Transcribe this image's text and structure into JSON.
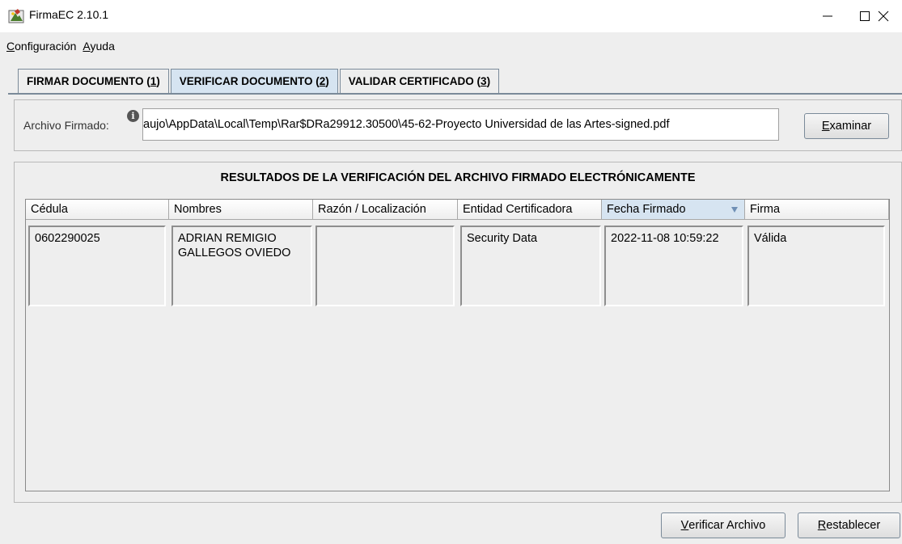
{
  "window": {
    "title": "FirmaEC 2.10.1",
    "controls": {
      "minimize": "—",
      "maximize": "☐",
      "close": "✕"
    }
  },
  "menu": {
    "items": [
      {
        "mnemonic": "C",
        "rest": "onfiguración"
      },
      {
        "mnemonic": "A",
        "rest": "yuda"
      }
    ]
  },
  "tabs": [
    {
      "label": "FIRMAR DOCUMENTO (",
      "mnemonic": "1",
      "close": ")",
      "active": false
    },
    {
      "label": "VERIFICAR DOCUMENTO (",
      "mnemonic": "2",
      "close": ")",
      "active": true
    },
    {
      "label": "VALIDAR CERTIFICADO (",
      "mnemonic": "3",
      "close": ")",
      "active": false
    }
  ],
  "file": {
    "label": "Archivo Firmado:",
    "value": "aujo\\AppData\\Local\\Temp\\Rar$DRa29912.30500\\45-62-Proyecto Universidad de las Artes-signed.pdf",
    "browse_mnemonic": "E",
    "browse_rest": "xaminar"
  },
  "results": {
    "title": "RESULTADOS DE LA VERIFICACIÓN DEL ARCHIVO FIRMADO ELECTRÓNICAMENTE",
    "columns": [
      "Cédula",
      "Nombres",
      "Razón / Localización",
      "Entidad Certificadora",
      "Fecha Firmado",
      "Firma"
    ],
    "sorted_column": "Fecha Firmado",
    "rows": [
      {
        "cedula": "0602290025",
        "nombres_line1": "ADRIAN REMIGIO",
        "nombres_line2": "GALLEGOS OVIEDO",
        "razon": "",
        "entidad": "Security Data",
        "fecha": "2022-11-08 10:59:22",
        "firma": "Válida"
      }
    ]
  },
  "actions": {
    "verify_mnemonic": "V",
    "verify_rest": "erificar Archivo",
    "reset_mnemonic": "R",
    "reset_rest": "establecer"
  },
  "colors": {
    "accent_tab": "#d6e4f1",
    "sort_arrow": "#6f8fb5"
  }
}
